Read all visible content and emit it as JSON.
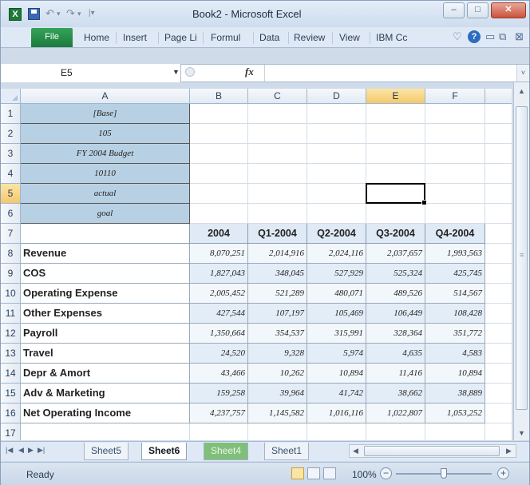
{
  "window": {
    "title": "Book2 - Microsoft Excel",
    "minimize": "–",
    "maximize": "□",
    "close": "✕"
  },
  "quick_access": {
    "app_icon": "X",
    "undo": "↶",
    "redo": "↷",
    "customize": "|▾"
  },
  "ribbon": {
    "tabs": [
      "File",
      "Home",
      "Insert",
      "Page Li",
      "Formul",
      "Data",
      "Review",
      "View",
      "IBM Cc"
    ],
    "minimize_ribbon": "♡",
    "help": "?",
    "window_min": "▭",
    "window_restore": "⧉",
    "window_close": "⊠"
  },
  "formula_bar": {
    "name_box": "E5",
    "fx": "fx",
    "value": ""
  },
  "grid": {
    "columns": [
      "A",
      "B",
      "C",
      "D",
      "E",
      "F"
    ],
    "rows": [
      "1",
      "2",
      "3",
      "4",
      "5",
      "6",
      "7",
      "8",
      "9",
      "10",
      "11",
      "12",
      "13",
      "14",
      "15",
      "16",
      "17"
    ],
    "selected_cell": "E5",
    "labels": [
      "[Base]",
      "105",
      "FY 2004 Budget",
      "10110",
      "actual",
      "goal"
    ],
    "header_row": [
      "2004",
      "Q1-2004",
      "Q2-2004",
      "Q3-2004",
      "Q4-2004"
    ],
    "data_rows": [
      {
        "label": "Revenue",
        "values": [
          "8,070,251",
          "2,014,916",
          "2,024,116",
          "2,037,657",
          "1,993,563"
        ]
      },
      {
        "label": "COS",
        "values": [
          "1,827,043",
          "348,045",
          "527,929",
          "525,324",
          "425,745"
        ]
      },
      {
        "label": "Operating Expense",
        "values": [
          "2,005,452",
          "521,289",
          "480,071",
          "489,526",
          "514,567"
        ]
      },
      {
        "label": "Other Expenses",
        "values": [
          "427,544",
          "107,197",
          "105,469",
          "106,449",
          "108,428"
        ]
      },
      {
        "label": "Payroll",
        "values": [
          "1,350,664",
          "354,537",
          "315,991",
          "328,364",
          "351,772"
        ]
      },
      {
        "label": "Travel",
        "values": [
          "24,520",
          "9,328",
          "5,974",
          "4,635",
          "4,583"
        ]
      },
      {
        "label": "Depr & Amort",
        "values": [
          "43,466",
          "10,262",
          "10,894",
          "11,416",
          "10,894"
        ]
      },
      {
        "label": "Adv & Marketing",
        "values": [
          "159,258",
          "39,964",
          "41,742",
          "38,662",
          "38,889"
        ]
      },
      {
        "label": "Net Operating Income",
        "values": [
          "4,237,757",
          "1,145,582",
          "1,016,116",
          "1,022,807",
          "1,053,252"
        ]
      }
    ]
  },
  "sheet_tabs": [
    "Sheet5",
    "Sheet6",
    "Sheet4",
    "Sheet1"
  ],
  "active_sheet": "Sheet6",
  "status": {
    "ready": "Ready",
    "zoom": "100%",
    "zoom_minus": "−",
    "zoom_plus": "+"
  }
}
